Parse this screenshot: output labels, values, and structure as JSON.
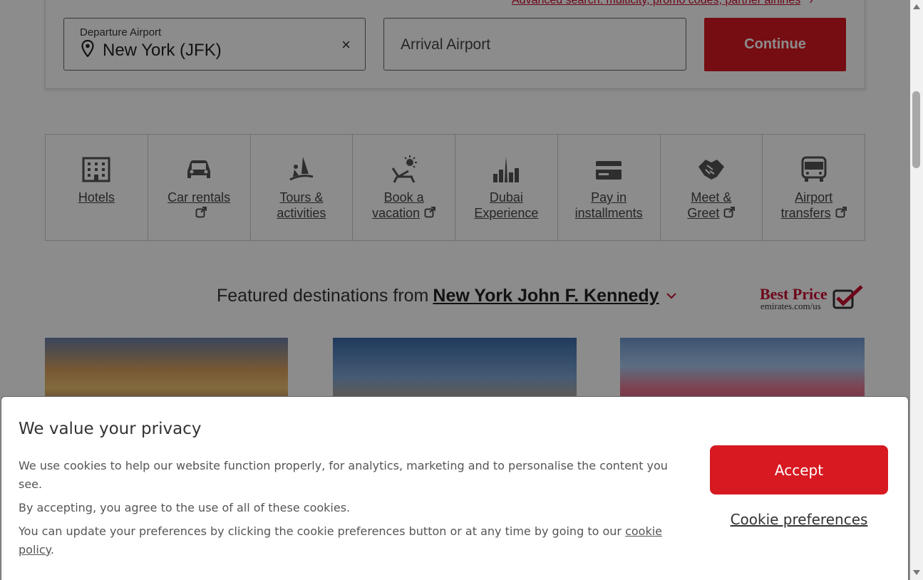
{
  "search": {
    "advanced_link": "Advanced search: multicity, promo codes, partner airlines",
    "departure_label": "Departure Airport",
    "departure_value": "New York (JFK)",
    "clear_symbol": "×",
    "arrival_placeholder": "Arrival Airport",
    "continue_label": "Continue"
  },
  "services": [
    {
      "label": "Hotels",
      "icon": "hotel-icon",
      "external": false
    },
    {
      "label": "Car rentals",
      "icon": "car-icon",
      "external": true
    },
    {
      "label": "Tours & activities",
      "icon": "windsurf-icon",
      "external": false
    },
    {
      "label": "Book a vacation",
      "icon": "beach-chair-icon",
      "external": true
    },
    {
      "label": "Dubai Experience",
      "icon": "dubai-skyline-icon",
      "external": false
    },
    {
      "label": "Pay in installments",
      "icon": "credit-card-icon",
      "external": false
    },
    {
      "label": "Meet & Greet",
      "icon": "handshake-icon",
      "external": true
    },
    {
      "label": "Airport transfers",
      "icon": "bus-icon",
      "external": true
    }
  ],
  "featured": {
    "prefix": "Featured destinations from",
    "city": "New York John F. Kennedy"
  },
  "best_price": {
    "title": "Best Price",
    "subtitle": "emirates.com/us"
  },
  "cookie": {
    "title": "We value your privacy",
    "text1": "We use cookies to help our website function properly, for analytics, marketing and to personalise the content you see.",
    "text2": "By accepting, you agree to the use of all of these cookies.",
    "text3_prefix": "You can update your preferences by clicking the cookie preferences button or at any time by going to our ",
    "text3_link": "cookie policy",
    "text3_suffix": ".",
    "accept_label": "Accept",
    "preferences_label": "Cookie preferences"
  },
  "colors": {
    "brand_red": "#d71921",
    "link_red": "#c60c30"
  }
}
